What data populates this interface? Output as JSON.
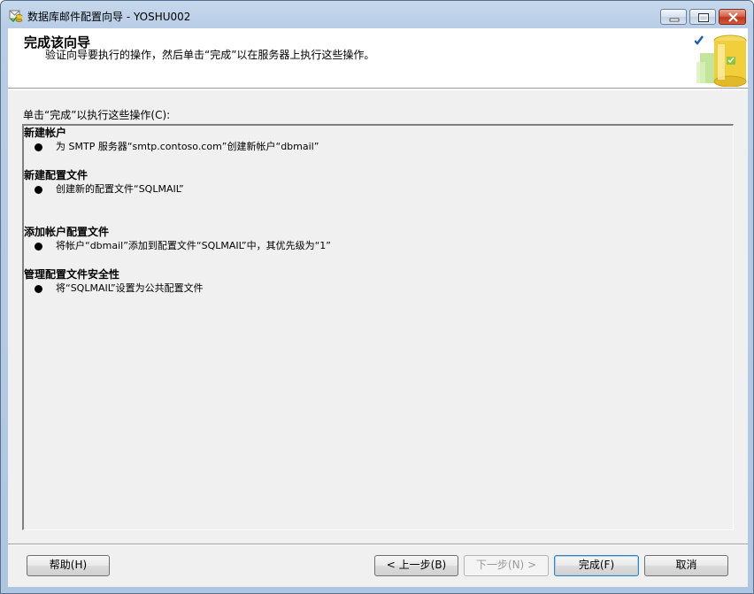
{
  "window": {
    "title": "数据库邮件配置向导 - YOSHU002",
    "icon": "database-mail-wizard-icon"
  },
  "header": {
    "title": "完成该向导",
    "subtitle": "验证向导要执行的操作，然后单击“完成”以在服务器上执行这些操作。",
    "image": "database-checkmark-icon"
  },
  "main": {
    "instruction": "单击“完成”以执行这些操作(C):",
    "sections": [
      {
        "heading": "新建帐户",
        "items": [
          "为 SMTP 服务器“smtp.contoso.com”创建新帐户“dbmail”"
        ]
      },
      {
        "heading": "新建配置文件",
        "items": [
          "创建新的配置文件“SQLMAIL”"
        ]
      },
      {
        "heading": "添加帐户配置文件",
        "items": [
          "将帐户“dbmail”添加到配置文件“SQLMAIL”中，其优先级为“1”"
        ]
      },
      {
        "heading": "管理配置文件安全性",
        "items": [
          "将“SQLMAIL”设置为公共配置文件"
        ]
      }
    ]
  },
  "footer": {
    "help_label": "帮助(H)",
    "back_label": "< 上一步(B)",
    "next_label": "下一步(N) >",
    "finish_label": "完成(F)",
    "cancel_label": "取消"
  },
  "colors": {
    "title_bar": "#b9cde6",
    "client_bg": "#f0f0f0",
    "close_button": "#c0381d"
  }
}
